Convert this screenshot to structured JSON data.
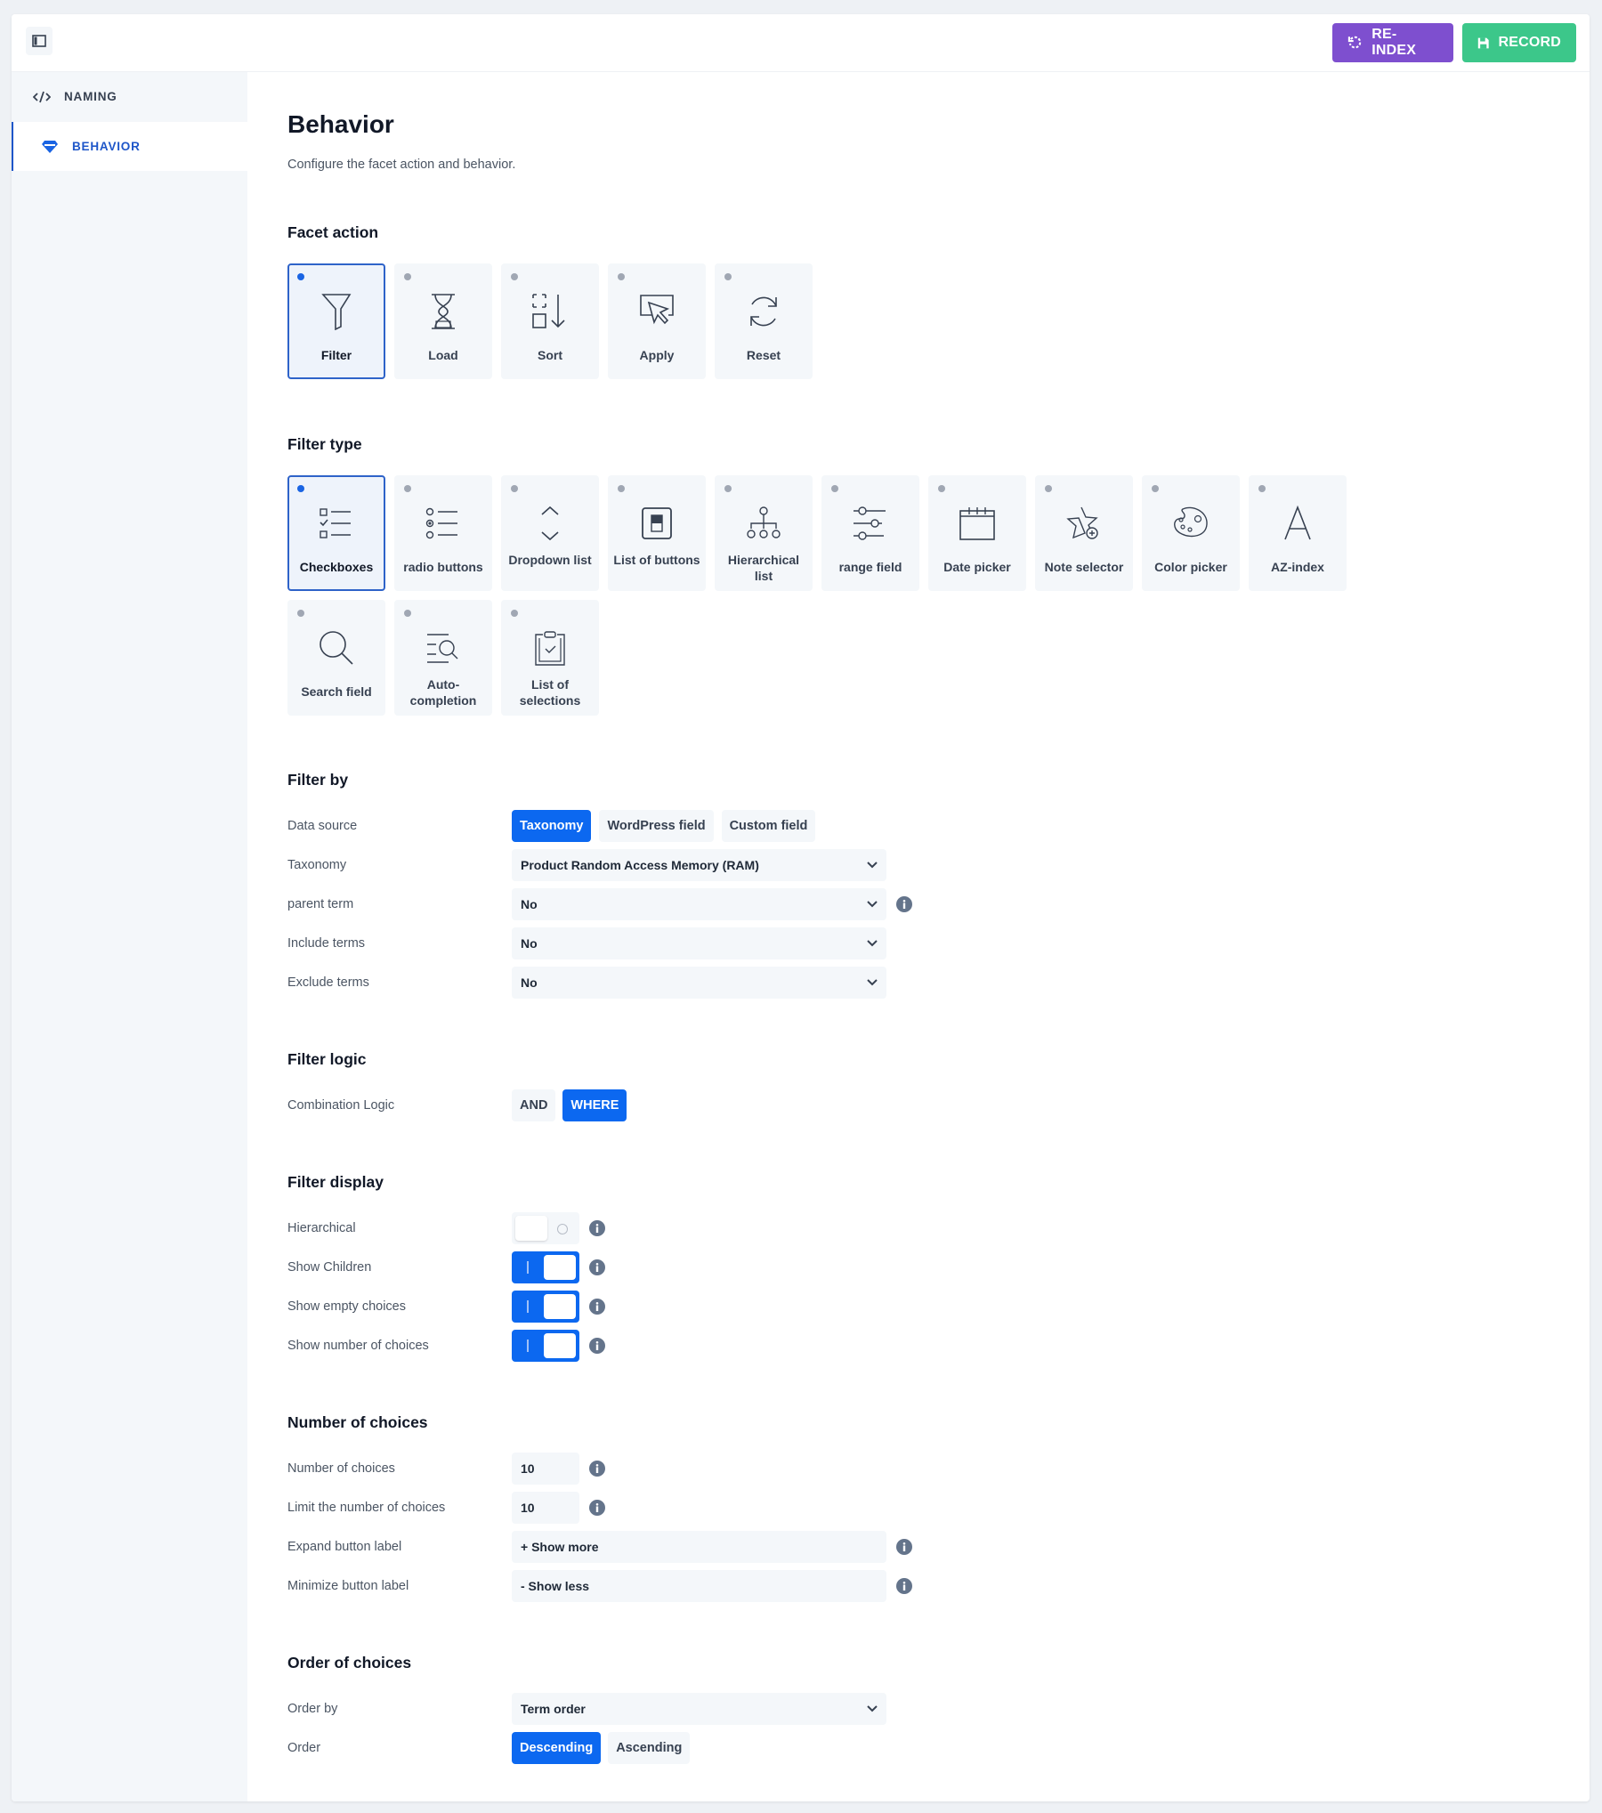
{
  "header": {
    "sidebar_toggle_icon": "sidebar-panel-icon",
    "reindex_label": "RE-INDEX",
    "reindex_icon": "refresh-icon",
    "record_label": "RECORD",
    "record_icon": "floppy-disk-icon",
    "colors": {
      "reindex": "#7e4fcf",
      "record": "#3cc78a",
      "accent": "#0c68f0"
    }
  },
  "sidebar": {
    "items": [
      {
        "label": "NAMING",
        "icon": "code-icon",
        "active": false
      },
      {
        "label": "BEHAVIOR",
        "icon": "diamond-icon",
        "active": true
      }
    ]
  },
  "page": {
    "title": "Behavior",
    "subtitle": "Configure the facet action and behavior."
  },
  "facet_action": {
    "heading": "Facet action",
    "options": [
      {
        "label": "Filter",
        "icon": "funnel-icon",
        "selected": true
      },
      {
        "label": "Load",
        "icon": "hourglass-icon",
        "selected": false
      },
      {
        "label": "Sort",
        "icon": "sort-icon",
        "selected": false
      },
      {
        "label": "Apply",
        "icon": "cursor-click-icon",
        "selected": false
      },
      {
        "label": "Reset",
        "icon": "refresh-icon",
        "selected": false
      }
    ]
  },
  "filter_type": {
    "heading": "Filter type",
    "options": [
      {
        "label": "Checkboxes",
        "icon": "checkbox-list-icon",
        "selected": true
      },
      {
        "label": "radio buttons",
        "icon": "radio-list-icon",
        "selected": false
      },
      {
        "label": "Dropdown list",
        "icon": "chevron-up-down-icon",
        "selected": false
      },
      {
        "label": "List of buttons",
        "icon": "toggle-button-icon",
        "selected": false
      },
      {
        "label": "Hierarchical list",
        "icon": "hierarchy-icon",
        "selected": false
      },
      {
        "label": "range field",
        "icon": "sliders-icon",
        "selected": false
      },
      {
        "label": "Date picker",
        "icon": "calendar-icon",
        "selected": false
      },
      {
        "label": "Note selector",
        "icon": "star-plus-icon",
        "selected": false
      },
      {
        "label": "Color picker",
        "icon": "palette-icon",
        "selected": false
      },
      {
        "label": "AZ-index",
        "icon": "letter-a-icon",
        "selected": false
      },
      {
        "label": "Search field",
        "icon": "search-icon",
        "selected": false
      },
      {
        "label": "Auto-completion",
        "icon": "list-search-icon",
        "selected": false
      },
      {
        "label": "List of selections",
        "icon": "clipboard-check-icon",
        "selected": false
      }
    ]
  },
  "filter_by": {
    "heading": "Filter by",
    "data_source": {
      "label": "Data source",
      "options": [
        "Taxonomy",
        "WordPress field",
        "Custom field"
      ],
      "selected": "Taxonomy"
    },
    "taxonomy": {
      "label": "Taxonomy",
      "value": "Product Random Access Memory (RAM)"
    },
    "parent_term": {
      "label": "parent term",
      "value": "No"
    },
    "include_terms": {
      "label": "Include terms",
      "value": "No"
    },
    "exclude_terms": {
      "label": "Exclude terms",
      "value": "No"
    }
  },
  "filter_logic": {
    "heading": "Filter logic",
    "combination": {
      "label": "Combination Logic",
      "options": [
        "AND",
        "WHERE"
      ],
      "selected": "WHERE"
    }
  },
  "filter_display": {
    "heading": "Filter display",
    "toggles": [
      {
        "label": "Hierarchical",
        "on": false
      },
      {
        "label": "Show Children",
        "on": true
      },
      {
        "label": "Show empty choices",
        "on": true
      },
      {
        "label": "Show number of choices",
        "on": true
      }
    ]
  },
  "number_of_choices": {
    "heading": "Number of choices",
    "number": {
      "label": "Number of choices",
      "value": "10"
    },
    "limit": {
      "label": "Limit the number of choices",
      "value": "10"
    },
    "expand": {
      "label": "Expand button label",
      "value": "+ Show more"
    },
    "minimize": {
      "label": "Minimize button label",
      "value": "- Show less"
    }
  },
  "order_of_choices": {
    "heading": "Order of choices",
    "order_by": {
      "label": "Order by",
      "value": "Term order"
    },
    "order": {
      "label": "Order",
      "options": [
        "Descending",
        "Ascending"
      ],
      "selected": "Descending"
    }
  }
}
